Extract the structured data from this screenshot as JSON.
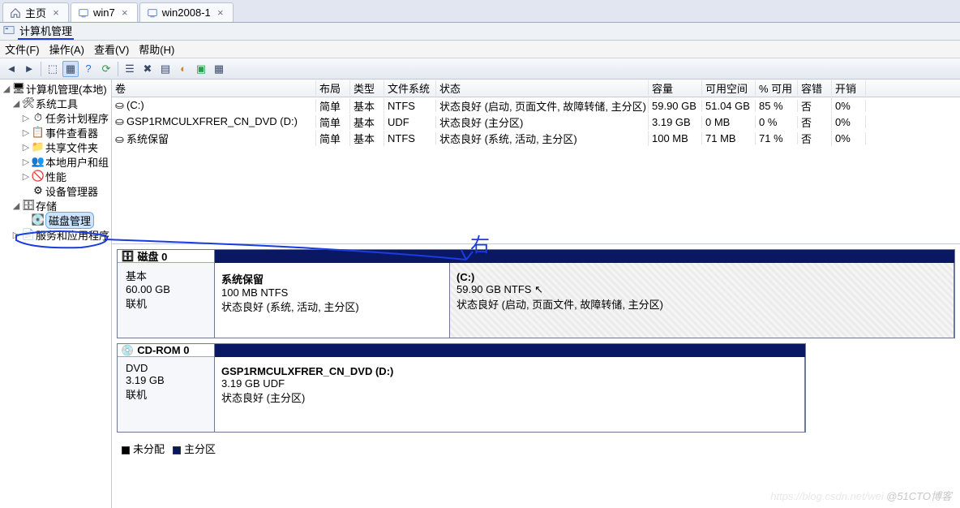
{
  "tabs": [
    {
      "label": "主页",
      "icon": "home",
      "active": false
    },
    {
      "label": "win7",
      "icon": "vm",
      "active": true
    },
    {
      "label": "win2008-1",
      "icon": "vm",
      "active": false
    }
  ],
  "window": {
    "title": "计算机管理"
  },
  "menu": [
    "文件(F)",
    "操作(A)",
    "查看(V)",
    "帮助(H)"
  ],
  "tree": {
    "root": "计算机管理(本地)",
    "system_tools": {
      "label": "系统工具",
      "children": [
        {
          "label": "任务计划程序",
          "icon": "clock"
        },
        {
          "label": "事件查看器",
          "icon": "event"
        },
        {
          "label": "共享文件夹",
          "icon": "folder"
        },
        {
          "label": "本地用户和组",
          "icon": "users"
        },
        {
          "label": "性能",
          "icon": "perf"
        },
        {
          "label": "设备管理器",
          "icon": "device"
        }
      ]
    },
    "storage": {
      "label": "存储",
      "child": "磁盘管理"
    },
    "services": {
      "label": "服务和应用程序"
    }
  },
  "vol_headers": {
    "vol": "卷",
    "layout": "布局",
    "type": "类型",
    "fs": "文件系统",
    "status": "状态",
    "cap": "容量",
    "free": "可用空间",
    "pct": "% 可用",
    "ft": "容错",
    "ov": "开销"
  },
  "volumes": [
    {
      "vol": "(C:)",
      "layout": "简单",
      "type": "基本",
      "fs": "NTFS",
      "status": "状态良好 (启动, 页面文件, 故障转储, 主分区)",
      "cap": "59.90 GB",
      "free": "51.04 GB",
      "pct": "85 %",
      "ft": "否",
      "ov": "0%"
    },
    {
      "vol": "GSP1RMCULXFRER_CN_DVD (D:)",
      "layout": "简单",
      "type": "基本",
      "fs": "UDF",
      "status": "状态良好 (主分区)",
      "cap": "3.19 GB",
      "free": "0 MB",
      "pct": "0 %",
      "ft": "否",
      "ov": "0%"
    },
    {
      "vol": "系统保留",
      "layout": "简单",
      "type": "基本",
      "fs": "NTFS",
      "status": "状态良好 (系统, 活动, 主分区)",
      "cap": "100 MB",
      "free": "71 MB",
      "pct": "71 %",
      "ft": "否",
      "ov": "0%"
    }
  ],
  "disk0": {
    "label": "磁盘 0",
    "kind": "基本",
    "size": "60.00 GB",
    "state": "联机",
    "p1": {
      "name": "系统保留",
      "sz": "100 MB NTFS",
      "stat": "状态良好 (系统, 活动, 主分区)"
    },
    "p2": {
      "name": "(C:)",
      "sz": "59.90 GB NTFS",
      "stat": "状态良好 (启动, 页面文件, 故障转储, 主分区)"
    }
  },
  "cdrom": {
    "label": "CD-ROM 0",
    "kind": "DVD",
    "size": "3.19 GB",
    "state": "联机",
    "p1": {
      "name": "GSP1RMCULXFRER_CN_DVD  (D:)",
      "sz": "3.19 GB UDF",
      "stat": "状态良好 (主分区)"
    }
  },
  "legend": {
    "unalloc": "未分配",
    "primary": "主分区"
  },
  "annotation": "右",
  "watermark": "@51CTO博客",
  "watermark_sub": "https://blog.csdn.net/wei"
}
